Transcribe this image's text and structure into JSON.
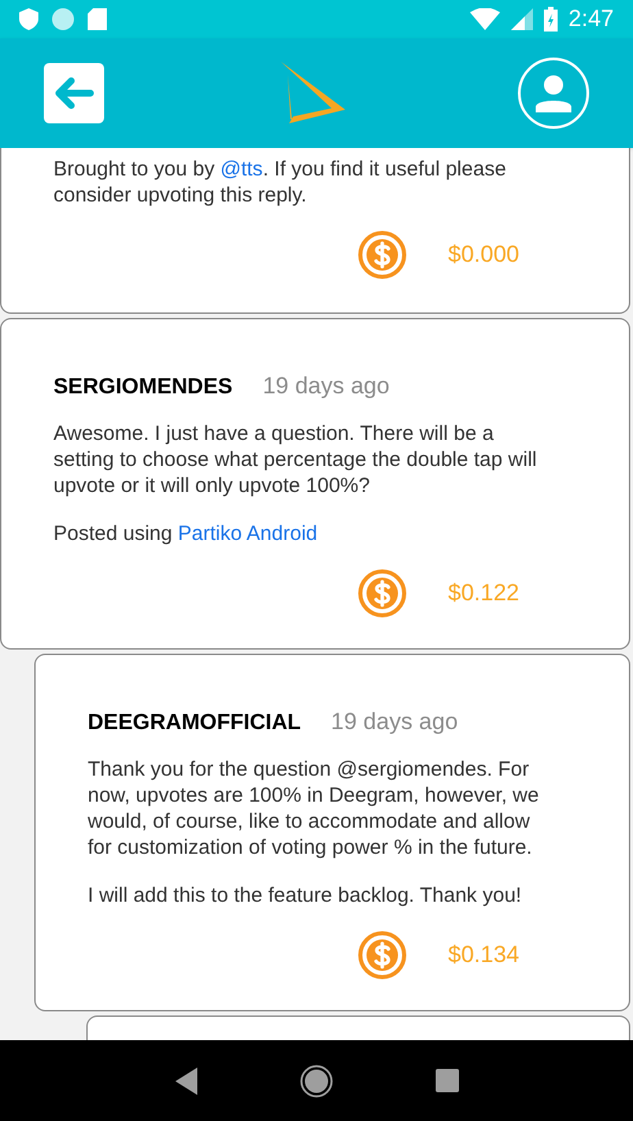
{
  "status_bar": {
    "time": "2:47"
  },
  "comments": [
    {
      "kind": "comment",
      "paragraphs": [
        [
          {
            "kind": "text",
            "text": "Brought to you by "
          },
          {
            "kind": "link",
            "text": "@tts"
          },
          {
            "kind": "text",
            "text": ". If you find it useful please consider upvoting this reply."
          }
        ]
      ],
      "payout": "$0.000"
    },
    {
      "kind": "comment",
      "author": "SERGIOMENDES",
      "age": "19 days ago",
      "paragraphs": [
        [
          {
            "kind": "text",
            "text": "Awesome. I just have a question. There will be a setting to choose what percentage the double tap will upvote or it will only upvote 100%?"
          }
        ],
        [
          {
            "kind": "text",
            "text": "Posted using "
          },
          {
            "kind": "link",
            "text": "Partiko Android"
          }
        ]
      ],
      "payout": "$0.122",
      "children": [
        {
          "kind": "comment",
          "author": "DEEGRAMOFFICIAL",
          "age": "19 days ago",
          "paragraphs": [
            [
              {
                "kind": "text",
                "text": "Thank you for the question @sergiomendes. For now, upvotes are 100% in Deegram, however, we would, of course, like to accommodate and allow for customization of voting power % in the future."
              }
            ],
            [
              {
                "kind": "text",
                "text": "I will add this to the feature backlog. Thank you!"
              }
            ]
          ],
          "payout": "$0.134",
          "children": [
            {
              "kind": "cut-off"
            }
          ]
        }
      ]
    }
  ]
}
